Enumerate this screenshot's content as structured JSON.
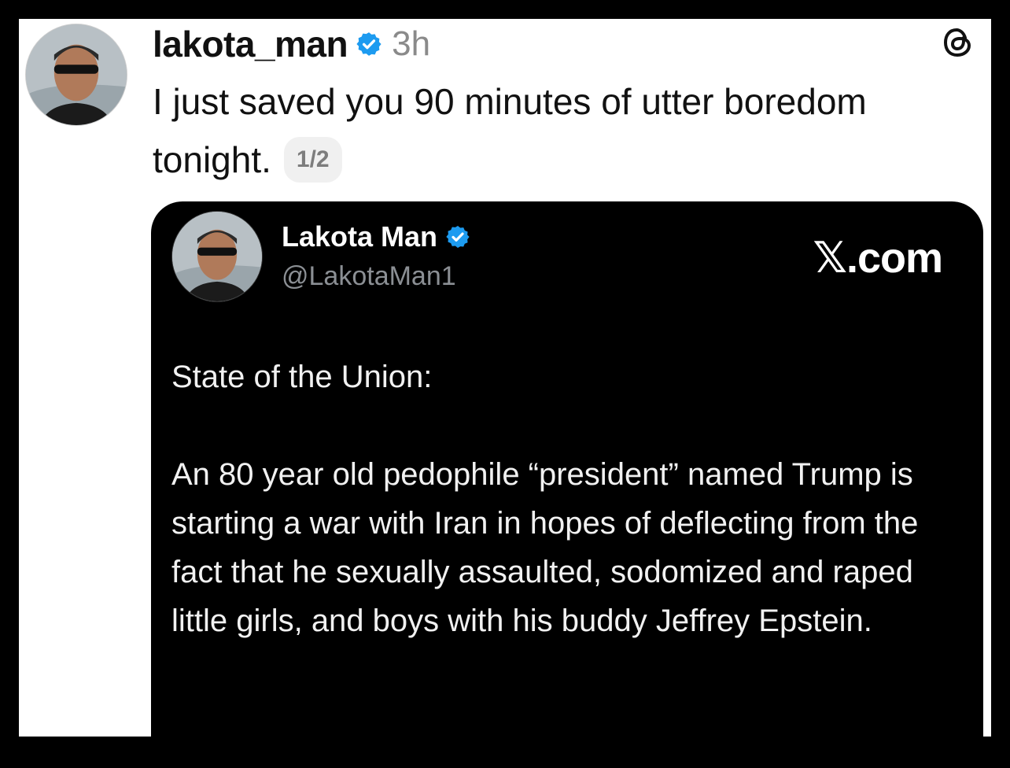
{
  "post": {
    "username": "lakota_man",
    "time": "3h",
    "text": "I just saved you 90 minutes of utter boredom tonight.",
    "page_indicator": "1/2"
  },
  "embedded": {
    "display_name": "Lakota Man",
    "handle": "@LakotaMan1",
    "source": "𝕏.com",
    "paragraphs": [
      "State of the Union:",
      "An 80 year old pedophile “president” named Trump is starting a war with Iran in hopes of deflecting from the fact that he sexually assaulted, sodomized and raped little girls, and boys with his buddy Jeffrey Epstein."
    ]
  },
  "icons": {
    "verified": "verified-badge-icon",
    "app": "threads-logo-icon"
  },
  "colors": {
    "verified_blue": "#1D9BF0",
    "card_background": "#000000",
    "muted_text": "#8A8A8A"
  }
}
